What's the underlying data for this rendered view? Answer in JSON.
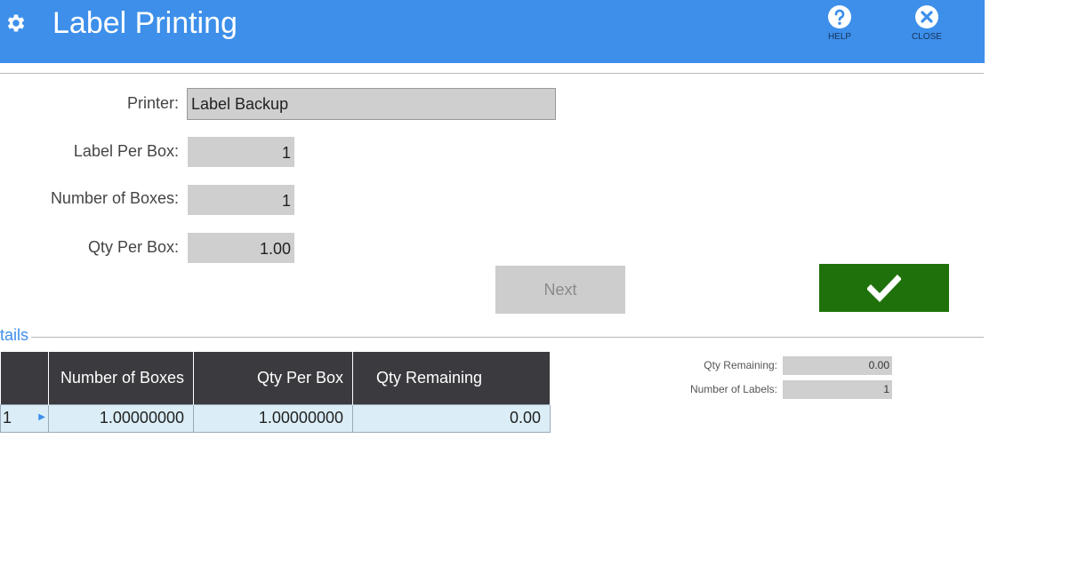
{
  "header": {
    "title": "Label Printing",
    "gear_icon": "gear-icon",
    "help_label": "HELP",
    "close_label": "CLOSE",
    "bg_color": "#3d8fea"
  },
  "form": {
    "printer_label": "Printer:",
    "printer_value": "Label Backup",
    "label_per_box_label": "Label Per Box:",
    "label_per_box_value": "1",
    "number_of_boxes_label": "Number of Boxes:",
    "number_of_boxes_value": "1",
    "qty_per_box_label": "Qty Per Box:",
    "qty_per_box_value": "1.00"
  },
  "actions": {
    "next_label": "Next",
    "confirm_icon": "checkmark-icon",
    "confirm_color": "#1f720b"
  },
  "details": {
    "section_title": "tails",
    "columns": [
      "",
      "Number of Boxes",
      "Qty Per Box",
      "Qty Remaining"
    ],
    "rows": [
      {
        "id": "1",
        "number_of_boxes": "1.00000000",
        "qty_per_box": "1.00000000",
        "qty_remaining": "0.00"
      }
    ]
  },
  "summary": {
    "qty_remaining_label": "Qty Remaining:",
    "qty_remaining_value": "0.00",
    "number_of_labels_label": "Number of Labels:",
    "number_of_labels_value": "1"
  }
}
